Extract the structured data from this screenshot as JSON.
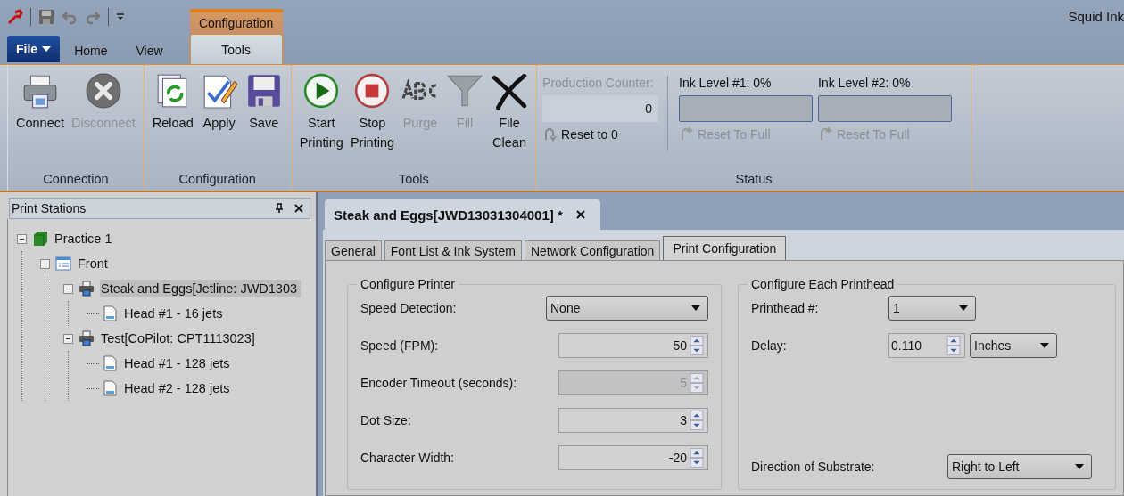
{
  "window": {
    "title": "Squid Ink"
  },
  "contextual_tab_group": {
    "label": "Configuration"
  },
  "ribbon_tabs": [
    {
      "label": "File",
      "kind": "file",
      "selected": false
    },
    {
      "label": "Home",
      "kind": "tab",
      "selected": false
    },
    {
      "label": "View",
      "kind": "tab",
      "selected": false
    },
    {
      "label": "Tools",
      "kind": "tab",
      "selected": true
    }
  ],
  "ribbon_groups": [
    {
      "title": "Connection",
      "buttons": [
        {
          "label": "Connect",
          "disabled": false
        },
        {
          "label": "Disconnect",
          "disabled": true
        }
      ]
    },
    {
      "title": "Configuration",
      "buttons": [
        {
          "label": "Reload",
          "disabled": false
        },
        {
          "label": "Apply",
          "disabled": false
        },
        {
          "label": "Save",
          "disabled": false
        }
      ]
    },
    {
      "title": "Tools",
      "buttons": [
        {
          "label": "Start Printing",
          "disabled": false
        },
        {
          "label": "Stop Printing",
          "disabled": false
        },
        {
          "label": "Purge",
          "disabled": true
        },
        {
          "label": "Fill",
          "disabled": true
        },
        {
          "label": "File Clean",
          "disabled": false
        }
      ]
    }
  ],
  "status_group": {
    "title": "Status",
    "counter": {
      "label": "Production Counter:",
      "value": "0",
      "disabled": true,
      "reset": {
        "label": "Reset to 0",
        "disabled": false
      }
    },
    "ink_levels": [
      {
        "label": "Ink Level #1: 0%",
        "level": 0,
        "reset": {
          "label": "Reset To Full",
          "disabled": true
        }
      },
      {
        "label": "Ink Level #2: 0%",
        "level": 0,
        "reset": {
          "label": "Reset To Full",
          "disabled": true
        }
      }
    ]
  },
  "side_panel": {
    "title": "Print Stations",
    "tree": [
      {
        "label": "Practice 1",
        "kind": "site",
        "expanded": true,
        "selected": false,
        "children": [
          {
            "label": "Front",
            "kind": "line",
            "expanded": true,
            "selected": false,
            "children": [
              {
                "label": "Steak and Eggs[Jetline: JWD1303",
                "kind": "printer",
                "expanded": true,
                "selected": true,
                "children": [
                  {
                    "label": "Head #1 - 16 jets",
                    "kind": "head",
                    "selected": false
                  }
                ]
              },
              {
                "label": "Test[CoPilot: CPT1113023]",
                "kind": "printer",
                "expanded": true,
                "selected": false,
                "children": [
                  {
                    "label": "Head #1 - 128 jets",
                    "kind": "head",
                    "selected": false
                  },
                  {
                    "label": "Head #2 - 128 jets",
                    "kind": "head",
                    "selected": false
                  }
                ]
              }
            ]
          }
        ]
      }
    ]
  },
  "document_tab": {
    "title": "Steak and Eggs[JWD13031304001] *"
  },
  "tabs": [
    {
      "label": "General",
      "selected": false
    },
    {
      "label": "Font List & Ink System",
      "selected": false
    },
    {
      "label": "Network Configuration",
      "selected": false
    },
    {
      "label": "Print Configuration",
      "selected": true
    }
  ],
  "sections": [
    {
      "title": "Configure Printer",
      "fields": [
        {
          "label": "Speed Detection:",
          "controls": [
            {
              "kind": "dropdown",
              "value": "None",
              "disabled": false
            }
          ]
        },
        {
          "label": "Speed (FPM):",
          "controls": [
            {
              "kind": "spin",
              "value": "50",
              "disabled": false
            }
          ]
        },
        {
          "label": "Encoder Timeout (seconds):",
          "controls": [
            {
              "kind": "spin",
              "value": "5",
              "disabled": true
            }
          ]
        },
        {
          "label": "Dot Size:",
          "controls": [
            {
              "kind": "spin",
              "value": "3",
              "disabled": false
            }
          ]
        },
        {
          "label": "Character Width:",
          "controls": [
            {
              "kind": "spin",
              "value": "-20",
              "disabled": false
            }
          ]
        }
      ]
    },
    {
      "title": "Configure Each Printhead",
      "fields": [
        {
          "label": "Printhead #:",
          "controls": [
            {
              "kind": "dropdown",
              "value": "1",
              "disabled": false
            }
          ]
        },
        {
          "label": "Delay:",
          "controls": [
            {
              "kind": "spin",
              "value": "0.110",
              "disabled": false
            },
            {
              "kind": "dropdown",
              "value": "Inches",
              "disabled": false
            }
          ]
        },
        {
          "label": "Direction of Substrate:",
          "controls": [
            {
              "kind": "dropdown",
              "value": "Right to Left",
              "disabled": false
            }
          ]
        }
      ]
    }
  ]
}
